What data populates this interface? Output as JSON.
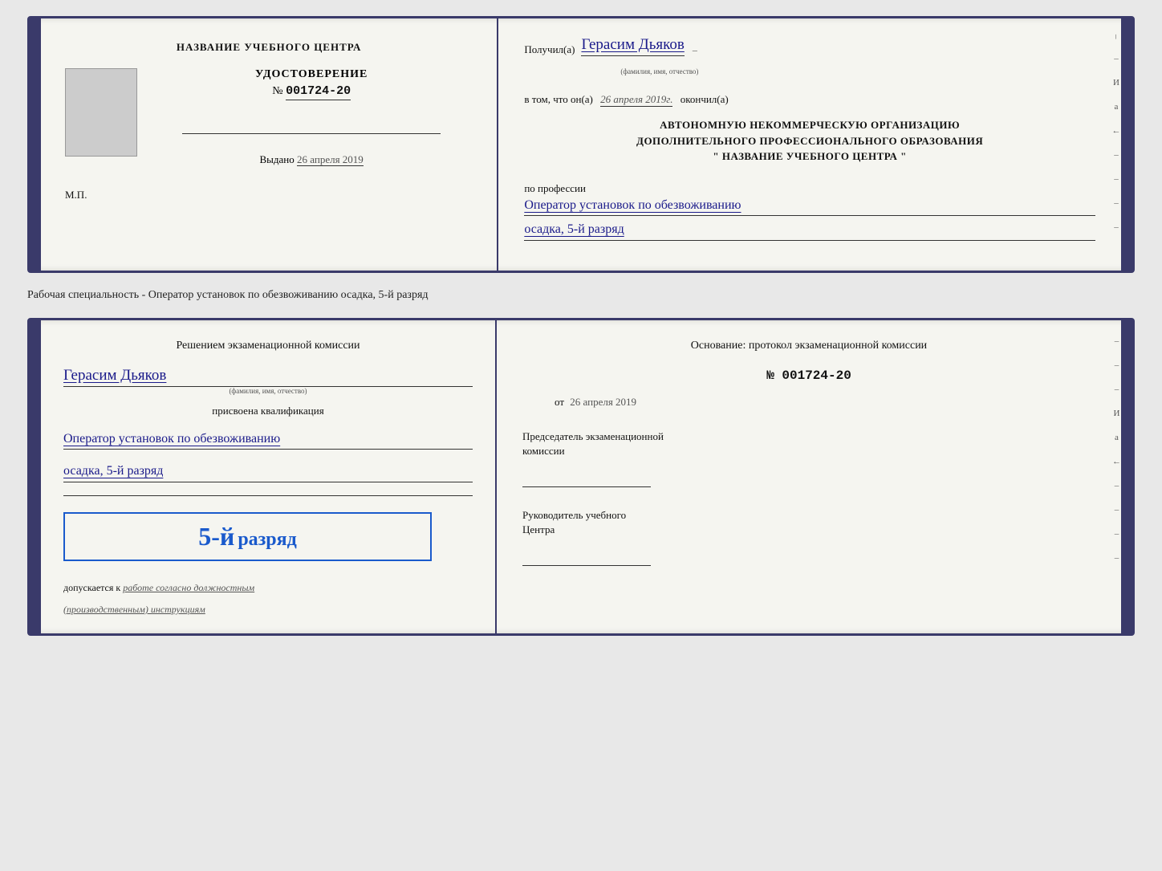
{
  "doc1": {
    "left": {
      "center_title": "НАЗВАНИЕ УЧЕБНОГО ЦЕНТРА",
      "cert_label": "УДОСТОВЕРЕНИЕ",
      "cert_number_prefix": "№",
      "cert_number": "001724-20",
      "issued_label": "Выдано",
      "issued_date": "26 апреля 2019",
      "mp_label": "М.П."
    },
    "right": {
      "recipient_prefix": "Получил(а)",
      "recipient_name": "Герасим Дьяков",
      "recipient_sub": "(фамилия, имя, отчество)",
      "date_prefix": "в том, что он(а)",
      "date_value": "26 апреля 2019г.",
      "date_suffix": "окончил(а)",
      "org_line1": "АВТОНОМНУЮ НЕКОММЕРЧЕСКУЮ ОРГАНИЗАЦИЮ",
      "org_line2": "ДОПОЛНИТЕЛЬНОГО ПРОФЕССИОНАЛЬНОГО ОБРАЗОВАНИЯ",
      "org_line3": "\"  НАЗВАНИЕ УЧЕБНОГО ЦЕНТРА  \"",
      "profession_label": "по профессии",
      "profession_handwritten": "Оператор установок по обезвоживанию",
      "rank_handwritten": "осадка, 5-й разряд"
    }
  },
  "specialty_line": "Рабочая специальность - Оператор установок по обезвоживанию осадка, 5-й разряд",
  "doc2": {
    "left": {
      "decision_title": "Решением экзаменационной комиссии",
      "person_name": "Герасим Дьяков",
      "person_sub": "(фамилия, имя, отчество)",
      "qualification_label": "присвоена квалификация",
      "qualification_value1": "Оператор установок по обезвоживанию",
      "qualification_value2": "осадка, 5-й разряд",
      "rank_big_number": "5-й",
      "rank_big_text": "разряд",
      "allowed_prefix": "допускается к",
      "allowed_handwritten": "работе согласно должностным",
      "allowed_parenthetical": "(производственным) инструкциям"
    },
    "right": {
      "basis_label": "Основание: протокол экзаменационной комиссии",
      "protocol_number": "№  001724-20",
      "from_label": "от",
      "from_date": "26 апреля 2019",
      "chairman_label": "Председатель экзаменационной",
      "chairman_label2": "комиссии",
      "director_label": "Руководитель учебного",
      "director_label2": "Центра"
    }
  }
}
